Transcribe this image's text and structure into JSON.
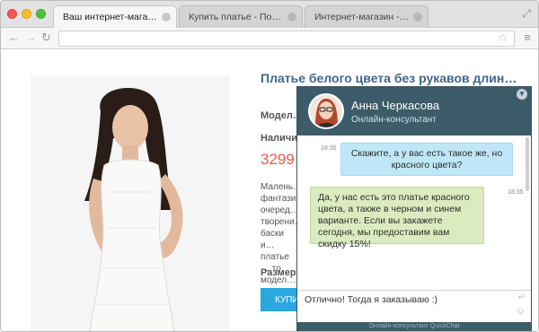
{
  "browser": {
    "tabs": [
      {
        "title": "Ваш интернет-магазин"
      },
      {
        "title": "Купить платье - Поис…"
      },
      {
        "title": "Интернет-магазин - к…"
      }
    ],
    "url": ""
  },
  "product": {
    "title": "Платье белого цвета без рукавов длин…",
    "model_label": "Модел…",
    "availability_label": "Наличи…",
    "price": "3299",
    "description": "Малень… фантази… очеред… творени… баски и… платье … то модел… взгляд, … ",
    "size_label": "Размер…",
    "buy_label": "КУПИ…"
  },
  "chat": {
    "agent_name": "Анна Черкасова",
    "agent_role": "Онлайн-консультант",
    "messages": [
      {
        "time": "18:35",
        "text": "Скажите, а у вас есть такое же, но красного цвета?"
      },
      {
        "time": "18:35",
        "text": "Да, у нас есть это платье красного цвета, а также в черном и синем варианте. Если вы закажете сегодня, мы предоставим вам скидку 15%!"
      }
    ],
    "input_value": "Отлично! Тогда я заказываю :)",
    "footer": "Онлайн-консультант QuickChat"
  },
  "colors": {
    "accent": "#40668c",
    "price": "#e05b4d",
    "chat_header": "#3d5c6a",
    "visitor_bubble": "#bfe7f7",
    "agent_bubble": "#dcebbf"
  },
  "icons": [
    "back-icon",
    "forward-icon",
    "reload-icon",
    "star-icon",
    "menu-icon",
    "expand-icon",
    "enter-icon",
    "smile-icon",
    "chevron-down-icon"
  ]
}
